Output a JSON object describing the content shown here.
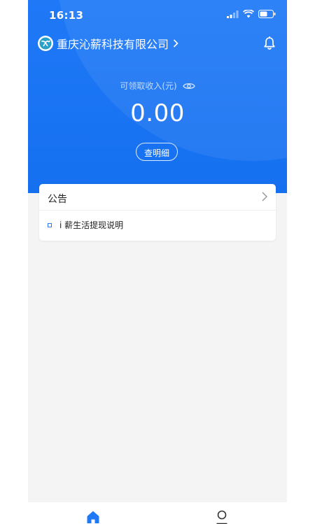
{
  "status_bar": {
    "time": "16:13",
    "signal_icon": "signal-icon",
    "wifi_icon": "wifi-icon",
    "battery_icon": "battery-icon"
  },
  "header": {
    "company_name": "重庆沁薪科技有限公司",
    "company_logo_icon": "company-logo-icon",
    "chevron_icon": "chevron-right-icon",
    "notification_icon": "bell-icon"
  },
  "earnings": {
    "label": "可领取收入(元)",
    "visibility_icon": "eye-icon",
    "amount": "0.00",
    "detail_button_label": "查明细"
  },
  "notice": {
    "title": "公告",
    "items": [
      {
        "text": "i 薪生活提现说明"
      }
    ]
  },
  "tabbar": {
    "tabs": [
      {
        "icon": "home-icon",
        "active": true
      },
      {
        "icon": "profile-icon",
        "active": false
      }
    ]
  },
  "colors": {
    "primary": "#1f79f7",
    "background": "#f4f4f5",
    "card": "#ffffff"
  }
}
